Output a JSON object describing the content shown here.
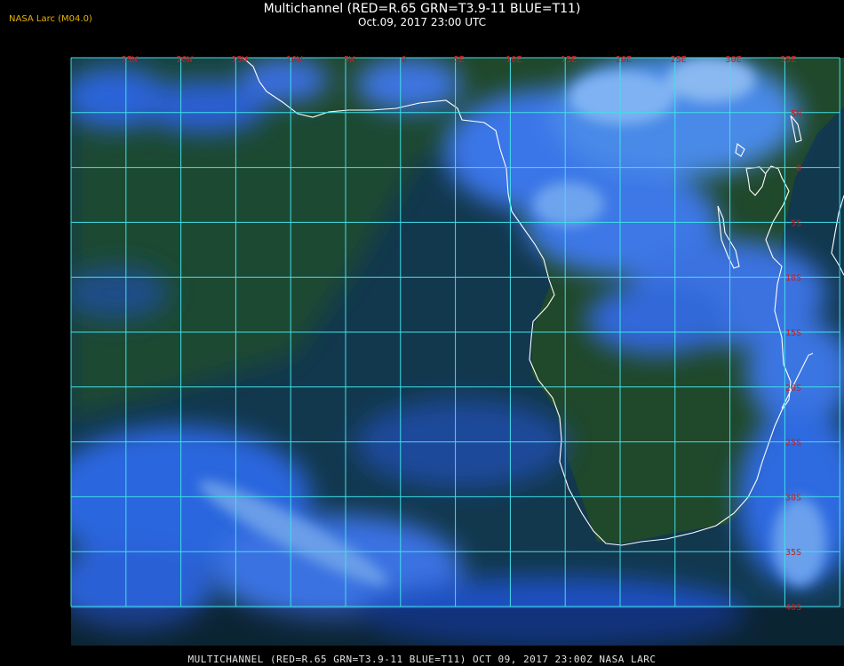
{
  "header": {
    "title": "Multichannel (RED=R.65 GRN=T3.9-11 BLUE=T11)",
    "datetime": "Oct.09, 2017 23:00 UTC",
    "agency_tag": "NASA Larc (M04.0)"
  },
  "footer": {
    "caption": "MULTICHANNEL (RED=R.65 GRN=T3.9-11 BLUE=T11) OCT 09, 2017 23:00Z    NASA LARC"
  },
  "map": {
    "longitude_labels": [
      "25W",
      "20W",
      "15W",
      "10W",
      "5W",
      "0",
      "5E",
      "10E",
      "15E",
      "20E",
      "25E",
      "30E",
      "35E"
    ],
    "latitude_labels": [
      "5N",
      "0",
      "5S",
      "10S",
      "15S",
      "20S",
      "25S",
      "30S",
      "35S",
      "40S"
    ],
    "colors": {
      "ocean": "#0e3a55",
      "land": "#1f4a2a",
      "cloud": "#2a6ae6",
      "grid": "#40e0e8",
      "coast": "#ffffff",
      "labels": "#cc1c1c"
    }
  }
}
